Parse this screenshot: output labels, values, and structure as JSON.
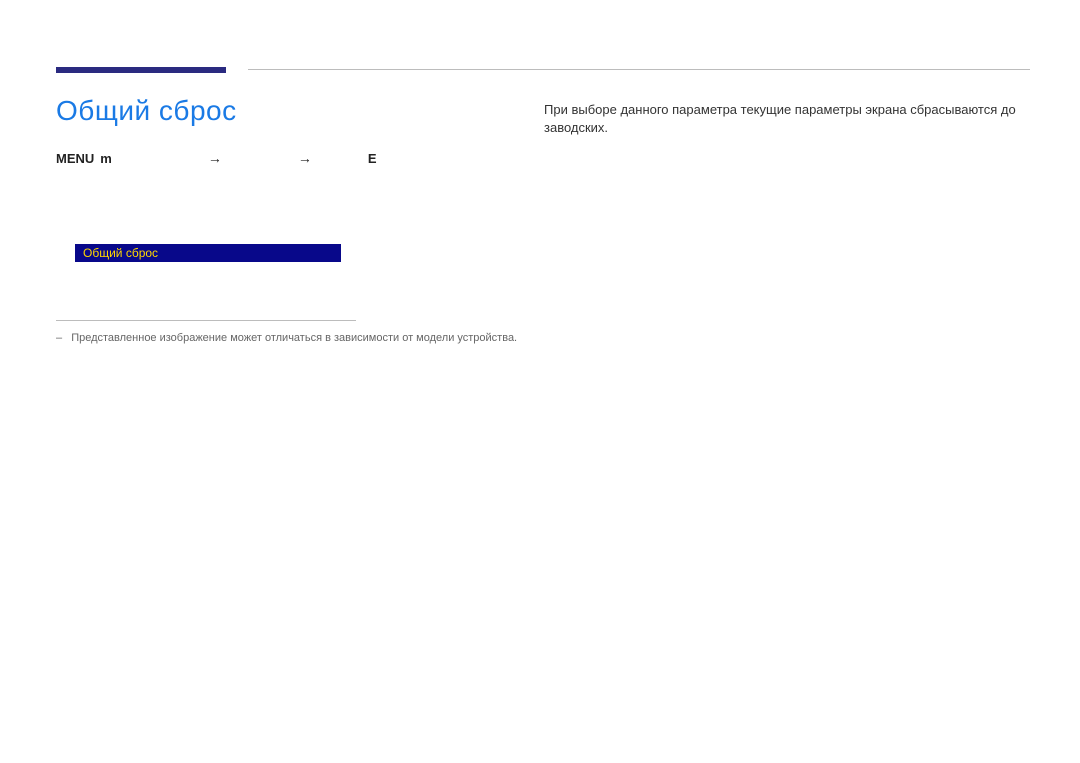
{
  "title": "Общий сброс",
  "menu_path": {
    "kbd": "MENU",
    "icon_glyph": "m",
    "arrow": "→",
    "terminal": "E"
  },
  "osd": {
    "label": "Общий сброс"
  },
  "footnote": {
    "dash": "–",
    "text": "Представленное изображение может отличаться в зависимости от модели устройства."
  },
  "description": "При выборе данного параметра текущие параметры экрана сбрасываются до заводских."
}
